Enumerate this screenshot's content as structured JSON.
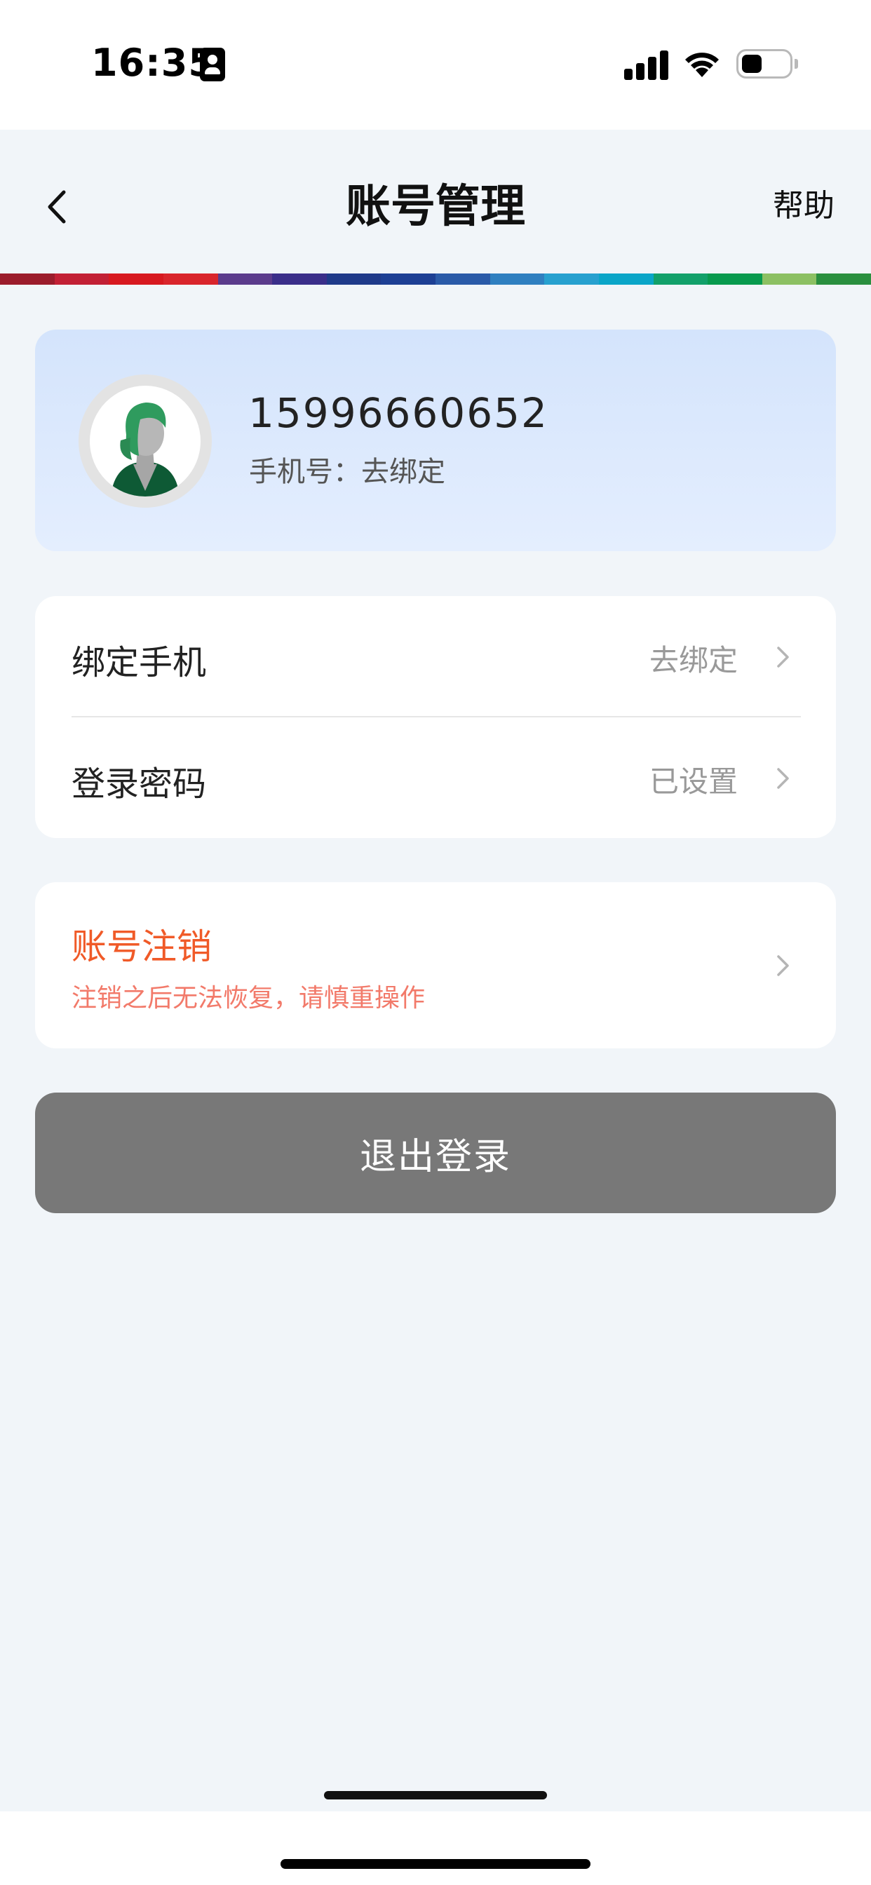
{
  "status_bar": {
    "time": "16:35",
    "icons": [
      "id-card-icon",
      "cellular-signal-icon",
      "wifi-icon",
      "battery-icon"
    ]
  },
  "nav": {
    "title": "账号管理",
    "help_label": "帮助",
    "back_icon": "chevron-left-icon"
  },
  "stripe_colors": [
    "#9b1c2c",
    "#c22035",
    "#d71920",
    "#d9252c",
    "#5b3b8c",
    "#3a2e8a",
    "#1f3a8a",
    "#1d3f94",
    "#2a5aa8",
    "#2f7fc0",
    "#27a0cf",
    "#0aa5c8",
    "#12a06a",
    "#089a4e",
    "#8cc063",
    "#2a8f3f"
  ],
  "profile": {
    "phone_number": "15996660652",
    "subtitle": "手机号：去绑定",
    "avatar_icon": "avatar-icon"
  },
  "settings": {
    "items": [
      {
        "label": "绑定手机",
        "value": "去绑定"
      },
      {
        "label": "登录密码",
        "value": "已设置"
      }
    ]
  },
  "cancel_account": {
    "title": "账号注销",
    "note": "注销之后无法恢复，请慎重操作"
  },
  "logout": {
    "label": "退出登录"
  },
  "colors": {
    "page_bg": "#f1f5f9",
    "profile_card": "#d8e6fd",
    "danger": "#f05a28",
    "danger_light": "#f27a6a",
    "logout_bg": "#787878"
  }
}
